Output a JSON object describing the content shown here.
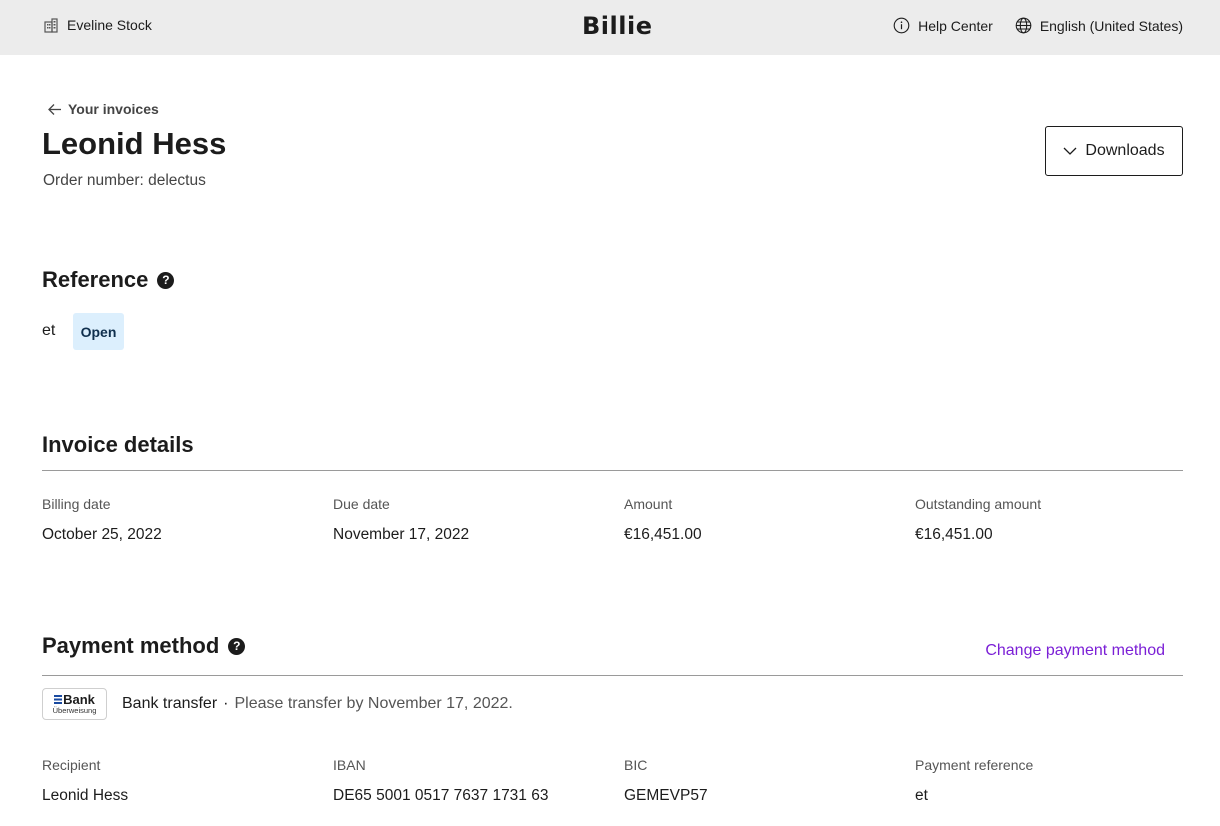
{
  "header": {
    "company_name": "Eveline Stock",
    "company_icon": "building-icon",
    "logo": "Billie",
    "help_label": "Help Center",
    "help_icon": "info-circle-icon",
    "language_label": "English (United States)",
    "language_icon": "globe-icon"
  },
  "page": {
    "back_label": "Your invoices",
    "title": "Leonid Hess",
    "order_number": "Order number: delectus",
    "downloads_label": "Downloads"
  },
  "reference": {
    "title": "Reference",
    "value": "et",
    "status": "Open"
  },
  "invoice_details": {
    "title": "Invoice details",
    "fields": [
      {
        "label": "Billing date",
        "value": "October 25, 2022"
      },
      {
        "label": "Due date",
        "value": "November 17, 2022"
      },
      {
        "label": "Amount",
        "value": "€16,451.00"
      },
      {
        "label": "Outstanding amount",
        "value": "€16,451.00"
      }
    ]
  },
  "payment_method": {
    "title": "Payment method",
    "change_label": "Change payment method",
    "bank_logo_top": "Bank",
    "bank_logo_bottom": "Überweisung",
    "method": "Bank transfer",
    "separator": "·",
    "note": "Please transfer by November 17, 2022.",
    "fields": [
      {
        "label": "Recipient",
        "value": "Leonid Hess"
      },
      {
        "label": "IBAN",
        "value": "DE65 5001 0517 7637 1731 63"
      },
      {
        "label": "BIC",
        "value": "GEMEVP57"
      },
      {
        "label": "Payment reference",
        "value": "et"
      }
    ]
  },
  "colors": {
    "topbar": "#ececec",
    "badge_bg": "#dceffd",
    "link": "#7b1fd6"
  }
}
